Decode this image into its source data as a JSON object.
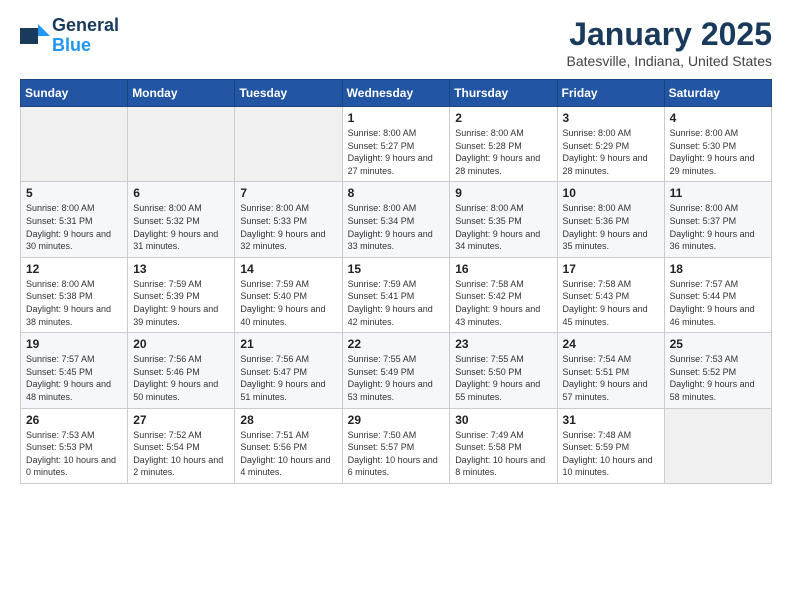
{
  "logo": {
    "line1": "General",
    "line2": "Blue"
  },
  "header": {
    "title": "January 2025",
    "subtitle": "Batesville, Indiana, United States"
  },
  "weekdays": [
    "Sunday",
    "Monday",
    "Tuesday",
    "Wednesday",
    "Thursday",
    "Friday",
    "Saturday"
  ],
  "weeks": [
    [
      {
        "day": "",
        "info": ""
      },
      {
        "day": "",
        "info": ""
      },
      {
        "day": "",
        "info": ""
      },
      {
        "day": "1",
        "info": "Sunrise: 8:00 AM\nSunset: 5:27 PM\nDaylight: 9 hours and 27 minutes."
      },
      {
        "day": "2",
        "info": "Sunrise: 8:00 AM\nSunset: 5:28 PM\nDaylight: 9 hours and 28 minutes."
      },
      {
        "day": "3",
        "info": "Sunrise: 8:00 AM\nSunset: 5:29 PM\nDaylight: 9 hours and 28 minutes."
      },
      {
        "day": "4",
        "info": "Sunrise: 8:00 AM\nSunset: 5:30 PM\nDaylight: 9 hours and 29 minutes."
      }
    ],
    [
      {
        "day": "5",
        "info": "Sunrise: 8:00 AM\nSunset: 5:31 PM\nDaylight: 9 hours and 30 minutes."
      },
      {
        "day": "6",
        "info": "Sunrise: 8:00 AM\nSunset: 5:32 PM\nDaylight: 9 hours and 31 minutes."
      },
      {
        "day": "7",
        "info": "Sunrise: 8:00 AM\nSunset: 5:33 PM\nDaylight: 9 hours and 32 minutes."
      },
      {
        "day": "8",
        "info": "Sunrise: 8:00 AM\nSunset: 5:34 PM\nDaylight: 9 hours and 33 minutes."
      },
      {
        "day": "9",
        "info": "Sunrise: 8:00 AM\nSunset: 5:35 PM\nDaylight: 9 hours and 34 minutes."
      },
      {
        "day": "10",
        "info": "Sunrise: 8:00 AM\nSunset: 5:36 PM\nDaylight: 9 hours and 35 minutes."
      },
      {
        "day": "11",
        "info": "Sunrise: 8:00 AM\nSunset: 5:37 PM\nDaylight: 9 hours and 36 minutes."
      }
    ],
    [
      {
        "day": "12",
        "info": "Sunrise: 8:00 AM\nSunset: 5:38 PM\nDaylight: 9 hours and 38 minutes."
      },
      {
        "day": "13",
        "info": "Sunrise: 7:59 AM\nSunset: 5:39 PM\nDaylight: 9 hours and 39 minutes."
      },
      {
        "day": "14",
        "info": "Sunrise: 7:59 AM\nSunset: 5:40 PM\nDaylight: 9 hours and 40 minutes."
      },
      {
        "day": "15",
        "info": "Sunrise: 7:59 AM\nSunset: 5:41 PM\nDaylight: 9 hours and 42 minutes."
      },
      {
        "day": "16",
        "info": "Sunrise: 7:58 AM\nSunset: 5:42 PM\nDaylight: 9 hours and 43 minutes."
      },
      {
        "day": "17",
        "info": "Sunrise: 7:58 AM\nSunset: 5:43 PM\nDaylight: 9 hours and 45 minutes."
      },
      {
        "day": "18",
        "info": "Sunrise: 7:57 AM\nSunset: 5:44 PM\nDaylight: 9 hours and 46 minutes."
      }
    ],
    [
      {
        "day": "19",
        "info": "Sunrise: 7:57 AM\nSunset: 5:45 PM\nDaylight: 9 hours and 48 minutes."
      },
      {
        "day": "20",
        "info": "Sunrise: 7:56 AM\nSunset: 5:46 PM\nDaylight: 9 hours and 50 minutes."
      },
      {
        "day": "21",
        "info": "Sunrise: 7:56 AM\nSunset: 5:47 PM\nDaylight: 9 hours and 51 minutes."
      },
      {
        "day": "22",
        "info": "Sunrise: 7:55 AM\nSunset: 5:49 PM\nDaylight: 9 hours and 53 minutes."
      },
      {
        "day": "23",
        "info": "Sunrise: 7:55 AM\nSunset: 5:50 PM\nDaylight: 9 hours and 55 minutes."
      },
      {
        "day": "24",
        "info": "Sunrise: 7:54 AM\nSunset: 5:51 PM\nDaylight: 9 hours and 57 minutes."
      },
      {
        "day": "25",
        "info": "Sunrise: 7:53 AM\nSunset: 5:52 PM\nDaylight: 9 hours and 58 minutes."
      }
    ],
    [
      {
        "day": "26",
        "info": "Sunrise: 7:53 AM\nSunset: 5:53 PM\nDaylight: 10 hours and 0 minutes."
      },
      {
        "day": "27",
        "info": "Sunrise: 7:52 AM\nSunset: 5:54 PM\nDaylight: 10 hours and 2 minutes."
      },
      {
        "day": "28",
        "info": "Sunrise: 7:51 AM\nSunset: 5:56 PM\nDaylight: 10 hours and 4 minutes."
      },
      {
        "day": "29",
        "info": "Sunrise: 7:50 AM\nSunset: 5:57 PM\nDaylight: 10 hours and 6 minutes."
      },
      {
        "day": "30",
        "info": "Sunrise: 7:49 AM\nSunset: 5:58 PM\nDaylight: 10 hours and 8 minutes."
      },
      {
        "day": "31",
        "info": "Sunrise: 7:48 AM\nSunset: 5:59 PM\nDaylight: 10 hours and 10 minutes."
      },
      {
        "day": "",
        "info": ""
      }
    ]
  ]
}
